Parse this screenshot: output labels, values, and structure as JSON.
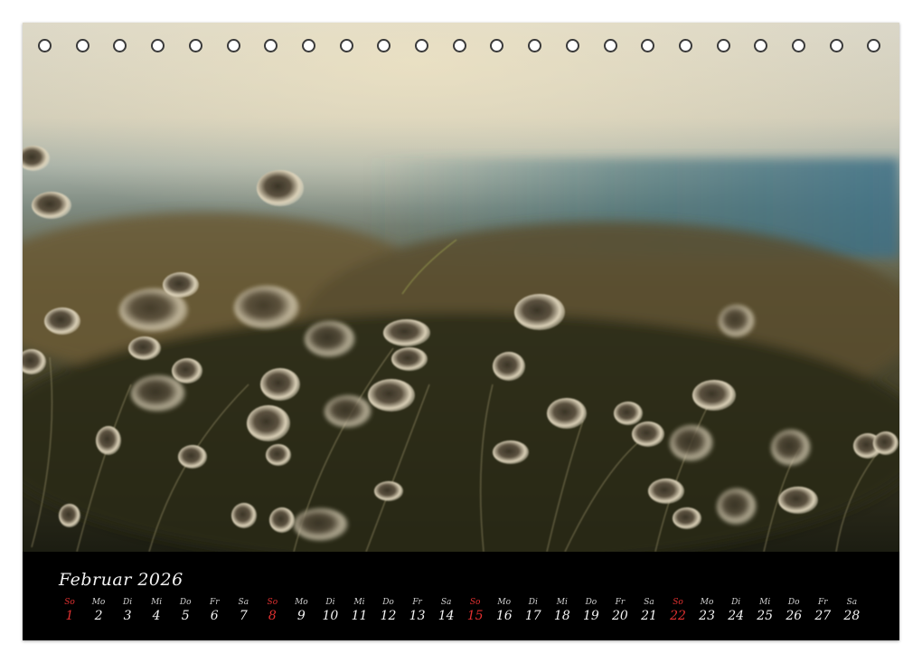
{
  "calendar": {
    "month_title": "Februar 2026",
    "days": [
      {
        "wd": "So",
        "num": "1",
        "sun": true
      },
      {
        "wd": "Mo",
        "num": "2",
        "sun": false
      },
      {
        "wd": "Di",
        "num": "3",
        "sun": false
      },
      {
        "wd": "Mi",
        "num": "4",
        "sun": false
      },
      {
        "wd": "Do",
        "num": "5",
        "sun": false
      },
      {
        "wd": "Fr",
        "num": "6",
        "sun": false
      },
      {
        "wd": "Sa",
        "num": "7",
        "sun": false
      },
      {
        "wd": "So",
        "num": "8",
        "sun": true
      },
      {
        "wd": "Mo",
        "num": "9",
        "sun": false
      },
      {
        "wd": "Di",
        "num": "10",
        "sun": false
      },
      {
        "wd": "Mi",
        "num": "11",
        "sun": false
      },
      {
        "wd": "Do",
        "num": "12",
        "sun": false
      },
      {
        "wd": "Fr",
        "num": "13",
        "sun": false
      },
      {
        "wd": "Sa",
        "num": "14",
        "sun": false
      },
      {
        "wd": "So",
        "num": "15",
        "sun": true
      },
      {
        "wd": "Mo",
        "num": "16",
        "sun": false
      },
      {
        "wd": "Di",
        "num": "17",
        "sun": false
      },
      {
        "wd": "Mi",
        "num": "18",
        "sun": false
      },
      {
        "wd": "Do",
        "num": "19",
        "sun": false
      },
      {
        "wd": "Fr",
        "num": "20",
        "sun": false
      },
      {
        "wd": "Sa",
        "num": "21",
        "sun": false
      },
      {
        "wd": "So",
        "num": "22",
        "sun": true
      },
      {
        "wd": "Mo",
        "num": "23",
        "sun": false
      },
      {
        "wd": "Di",
        "num": "24",
        "sun": false
      },
      {
        "wd": "Mi",
        "num": "25",
        "sun": false
      },
      {
        "wd": "Do",
        "num": "26",
        "sun": false
      },
      {
        "wd": "Fr",
        "num": "27",
        "sun": false
      },
      {
        "wd": "Sa",
        "num": "28",
        "sun": false
      }
    ]
  },
  "colors": {
    "sunday": "#e03030",
    "bar_background": "#000000"
  }
}
